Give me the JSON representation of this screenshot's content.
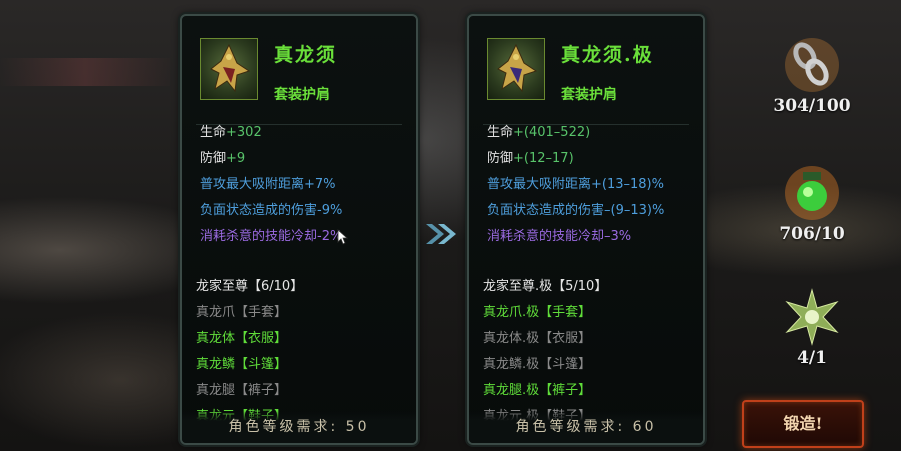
{
  "left": {
    "name": "真龙须",
    "type": "套装护肩",
    "stats": [
      {
        "label": "生命",
        "value": "+302",
        "style": "white"
      },
      {
        "label": "防御",
        "value": "+9",
        "style": "white"
      },
      {
        "label": "普攻最大吸附距离+7%",
        "value": "",
        "style": "blue"
      },
      {
        "label": "负面状态造成的伤害-9%",
        "value": "",
        "style": "blue"
      },
      {
        "label": "消耗杀意的技能冷却-2%",
        "value": "",
        "style": "purple"
      }
    ],
    "set_title": "龙家至尊【6/10】",
    "set_items": [
      {
        "label": "真龙爪【手套】",
        "on": false
      },
      {
        "label": "真龙体【衣服】",
        "on": true
      },
      {
        "label": "真龙鳞【斗篷】",
        "on": true
      },
      {
        "label": "真龙腿【裤子】",
        "on": false
      },
      {
        "label": "真龙元【鞋子】",
        "on": true
      }
    ],
    "requirement": "角色等级需求: 50"
  },
  "right": {
    "name": "真龙须.极",
    "type": "套装护肩",
    "stats": [
      {
        "label": "生命",
        "value": "+(401–522)",
        "style": "white"
      },
      {
        "label": "防御",
        "value": "+(12–17)",
        "style": "white"
      },
      {
        "label": "普攻最大吸附距离+(13–18)%",
        "value": "",
        "style": "blue"
      },
      {
        "label": "负面状态造成的伤害–(9–13)%",
        "value": "",
        "style": "blue"
      },
      {
        "label": "消耗杀意的技能冷却–3%",
        "value": "",
        "style": "purple"
      }
    ],
    "set_title": "龙家至尊.极【5/10】",
    "set_items": [
      {
        "label": "真龙爪.极【手套】",
        "on": true
      },
      {
        "label": "真龙体.极【衣服】",
        "on": false
      },
      {
        "label": "真龙鳞.极【斗篷】",
        "on": false
      },
      {
        "label": "真龙腿.极【裤子】",
        "on": true
      },
      {
        "label": "真龙元.极【鞋子】",
        "on": false
      }
    ],
    "requirement": "角色等级需求: 60"
  },
  "materials": [
    {
      "icon": "chain-icon",
      "count": "304/100"
    },
    {
      "icon": "green-gem-icon",
      "count": "706/10"
    },
    {
      "icon": "leaf-star-icon",
      "count": "4/1"
    }
  ],
  "forge_label": "锻造!",
  "colors": {
    "green": "#60dd3a",
    "blue": "#4e9edc",
    "purple": "#9a6ae0",
    "forge": "#c0401a"
  }
}
